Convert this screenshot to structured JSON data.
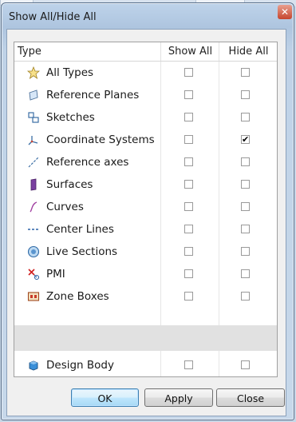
{
  "window": {
    "title": "Show All/Hide All",
    "close_glyph": "✕"
  },
  "columns": {
    "type": "Type",
    "show_all": "Show All",
    "hide_all": "Hide All"
  },
  "check_glyph": "✔",
  "rows": [
    {
      "label": "All Types",
      "icon": "star-icon",
      "show_all": false,
      "hide_all": false
    },
    {
      "label": "Reference Planes",
      "icon": "plane-icon",
      "show_all": false,
      "hide_all": false
    },
    {
      "label": "Sketches",
      "icon": "sketch-icon",
      "show_all": false,
      "hide_all": false
    },
    {
      "label": "Coordinate Systems",
      "icon": "coordinate-system-icon",
      "show_all": false,
      "hide_all": true
    },
    {
      "label": "Reference axes",
      "icon": "axis-icon",
      "show_all": false,
      "hide_all": false
    },
    {
      "label": "Surfaces",
      "icon": "surface-icon",
      "show_all": false,
      "hide_all": false
    },
    {
      "label": "Curves",
      "icon": "curve-icon",
      "show_all": false,
      "hide_all": false
    },
    {
      "label": "Center Lines",
      "icon": "center-line-icon",
      "show_all": false,
      "hide_all": false
    },
    {
      "label": "Live Sections",
      "icon": "live-section-icon",
      "show_all": false,
      "hide_all": false
    },
    {
      "label": "PMI",
      "icon": "pmi-icon",
      "show_all": false,
      "hide_all": false
    },
    {
      "label": "Zone Boxes",
      "icon": "zone-box-icon",
      "show_all": false,
      "hide_all": false
    },
    {
      "label": "Design Body",
      "icon": "design-body-icon",
      "show_all": false,
      "hide_all": false
    }
  ],
  "buttons": {
    "ok": "OK",
    "apply": "Apply",
    "close": "Close"
  },
  "colors": {
    "accent": "#3c7fb1",
    "title_bar": "#aec5df",
    "list_bg": "#ffffff"
  }
}
